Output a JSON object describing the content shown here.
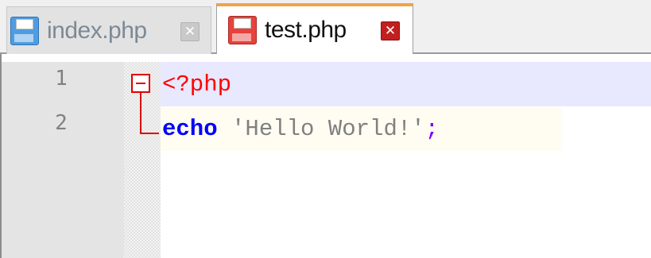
{
  "tabs": [
    {
      "label": "index.php",
      "active": false,
      "icon": "floppy-disk-icon",
      "close_icon": "close-icon"
    },
    {
      "label": "test.php",
      "active": true,
      "icon": "floppy-disk-unsaved-icon",
      "close_icon": "close-icon"
    }
  ],
  "editor": {
    "lines": [
      {
        "number": "1",
        "tokens": [
          {
            "type": "php-tag",
            "text": "<?php"
          }
        ]
      },
      {
        "number": "2",
        "tokens": [
          {
            "type": "keyword",
            "text": "echo"
          },
          {
            "type": "space",
            "text": " "
          },
          {
            "type": "string",
            "text": "'Hello World!'"
          },
          {
            "type": "operator",
            "text": ";"
          }
        ]
      }
    ],
    "fold_icon": "fold-collapse-icon"
  },
  "colors": {
    "active_tab_accent": "#f2a24a",
    "php_tag": "#ff0000",
    "keyword": "#0000ff",
    "string": "#808080",
    "operator": "#8000ff",
    "current_line": "#e8e8ff"
  }
}
